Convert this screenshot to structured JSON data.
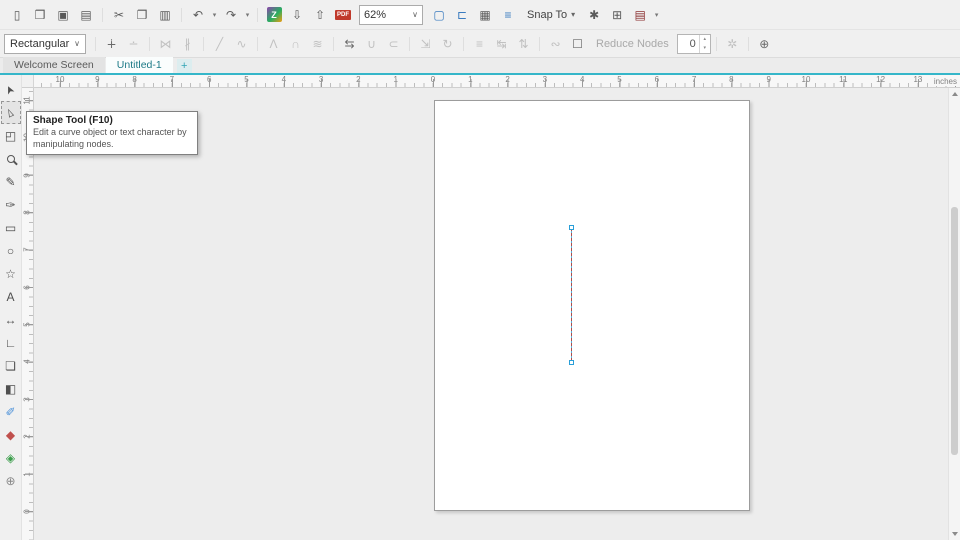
{
  "app": {
    "accent": "#35b6c9",
    "chrome_bg": "#f0f0f0"
  },
  "glyphs": {
    "combo_arrow": "∨",
    "dropdown": "▾",
    "spinner_up": "▴",
    "spinner_down": "▾"
  },
  "toolbar": {
    "zoom_value": "62%",
    "snap_label": "Snap To",
    "items": [
      {
        "name": "new-document-icon",
        "glyph": "▯"
      },
      {
        "name": "open-document-icon",
        "glyph": "❒"
      },
      {
        "name": "save-icon",
        "glyph": "▣"
      },
      {
        "name": "print-icon",
        "glyph": "▤"
      },
      {
        "sep": true
      },
      {
        "name": "cut-icon",
        "glyph": "✂"
      },
      {
        "name": "copy-icon",
        "glyph": "❐"
      },
      {
        "name": "paste-icon",
        "glyph": "▥"
      },
      {
        "sep": true
      },
      {
        "name": "undo-icon",
        "glyph": "↶"
      },
      {
        "name": "undo-dropdown-icon",
        "glyph": "▾",
        "small": true
      },
      {
        "name": "redo-icon",
        "glyph": "↷"
      },
      {
        "name": "redo-dropdown-icon",
        "glyph": "▾",
        "small": true
      },
      {
        "sep": true
      },
      {
        "name": "search-content-icon",
        "glyph": "Z",
        "special": "zbadge"
      },
      {
        "name": "import-icon",
        "glyph": "⇩"
      },
      {
        "name": "export-icon",
        "glyph": "⇧"
      },
      {
        "name": "publish-to-pdf-icon",
        "glyph": "PDF",
        "special": "pdf"
      },
      {
        "special": "zoom-combo"
      },
      {
        "name": "full-screen-preview-icon",
        "glyph": "▢",
        "color": "#3a7bbf"
      },
      {
        "name": "show-rulers-icon",
        "glyph": "⊏",
        "color": "#3a7bbf"
      },
      {
        "name": "show-grid-icon",
        "glyph": "▦"
      },
      {
        "name": "show-guidelines-icon",
        "glyph": "≡",
        "color": "#3a7bbf"
      },
      {
        "special": "snap"
      },
      {
        "name": "options-icon",
        "glyph": "✱"
      },
      {
        "name": "application-launcher-icon",
        "glyph": "⊞"
      },
      {
        "name": "workspace-icon",
        "glyph": "▤",
        "color": "#8b3030"
      },
      {
        "name": "workspace-dropdown-icon",
        "glyph": "▾",
        "small": true
      }
    ]
  },
  "property_bar": {
    "selection_mode": "Rectangular",
    "reduce_nodes_label": "Reduce Nodes",
    "smoothness_value": "0",
    "items": [
      {
        "special": "mode-combo"
      },
      {
        "sep": true
      },
      {
        "name": "add-nodes-icon",
        "glyph": "∔"
      },
      {
        "name": "delete-nodes-icon",
        "glyph": "∸",
        "disabled": true
      },
      {
        "sep": true
      },
      {
        "name": "join-nodes-icon",
        "glyph": "⋈",
        "disabled": true
      },
      {
        "name": "break-curve-icon",
        "glyph": "∦",
        "disabled": true
      },
      {
        "sep": true
      },
      {
        "name": "convert-to-line-icon",
        "glyph": "╱",
        "disabled": true
      },
      {
        "name": "convert-to-curve-icon",
        "glyph": "∿",
        "disabled": true
      },
      {
        "sep": true
      },
      {
        "name": "cusp-node-icon",
        "glyph": "Λ",
        "disabled": true
      },
      {
        "name": "smooth-node-icon",
        "glyph": "∩",
        "disabled": true
      },
      {
        "name": "symmetrical-node-icon",
        "glyph": "≋",
        "disabled": true
      },
      {
        "sep": true
      },
      {
        "name": "reverse-direction-icon",
        "glyph": "⇆"
      },
      {
        "name": "close-curve-icon",
        "glyph": "∪",
        "disabled": true
      },
      {
        "name": "extract-subpath-icon",
        "glyph": "⊂",
        "disabled": true
      },
      {
        "sep": true
      },
      {
        "name": "stretch-nodes-icon",
        "glyph": "⇲",
        "disabled": true
      },
      {
        "name": "rotate-skew-nodes-icon",
        "glyph": "↻",
        "disabled": true
      },
      {
        "sep": true
      },
      {
        "name": "align-nodes-icon",
        "glyph": "≡",
        "disabled": true
      },
      {
        "name": "reflect-horizontal-icon",
        "glyph": "↹",
        "disabled": true
      },
      {
        "name": "reflect-vertical-icon",
        "glyph": "⇅",
        "disabled": true
      },
      {
        "sep": true
      },
      {
        "name": "elastic-mode-icon",
        "glyph": "∾",
        "disabled": true
      },
      {
        "name": "select-all-nodes-icon",
        "glyph": "☐"
      },
      {
        "special": "reduce-label"
      },
      {
        "special": "spinner"
      },
      {
        "sep": true
      },
      {
        "name": "curve-smoothness-icon",
        "glyph": "✲",
        "disabled": true
      },
      {
        "sep": true
      },
      {
        "name": "more-options-icon",
        "glyph": "⊕"
      }
    ]
  },
  "tabs": {
    "items": [
      {
        "label": "Welcome Screen",
        "active": false
      },
      {
        "label": "Untitled-1",
        "active": true
      }
    ],
    "new_tab_label": "+"
  },
  "rulers": {
    "unit_label": "inches",
    "horizontal": [
      "10",
      "9",
      "8",
      "7",
      "6",
      "5",
      "4",
      "3",
      "2",
      "1",
      "0",
      "1",
      "2",
      "3",
      "4",
      "5",
      "6",
      "7",
      "8",
      "9",
      "10",
      "11",
      "12",
      "13"
    ],
    "vertical": [
      "11",
      "10",
      "9",
      "8",
      "7",
      "6",
      "5",
      "4",
      "3",
      "2",
      "1",
      "0"
    ]
  },
  "toolbox": {
    "tools": [
      {
        "name": "pick-tool",
        "glyph": "➤",
        "cls": "rot-arrow"
      },
      {
        "name": "shape-tool",
        "glyph": "▻",
        "cls": "rot-arrow",
        "selected": true
      },
      {
        "name": "crop-tool",
        "glyph": "◰"
      },
      {
        "name": "zoom-tool",
        "special": "magnifier"
      },
      {
        "name": "freehand-tool",
        "glyph": "✎"
      },
      {
        "name": "artistic-media-tool",
        "glyph": "✑"
      },
      {
        "name": "rectangle-tool",
        "glyph": "▭"
      },
      {
        "name": "ellipse-tool",
        "glyph": "○"
      },
      {
        "name": "polygon-tool",
        "glyph": "☆"
      },
      {
        "name": "text-tool",
        "glyph": "A"
      },
      {
        "name": "parallel-dimension-tool",
        "glyph": "↔"
      },
      {
        "name": "connector-tool",
        "glyph": "∟"
      },
      {
        "name": "drop-shadow-tool",
        "glyph": "❏"
      },
      {
        "name": "transparency-tool",
        "glyph": "◧"
      },
      {
        "name": "color-eyedropper-tool",
        "glyph": "✐",
        "color": "#4a90d9"
      },
      {
        "name": "interactive-fill-tool",
        "glyph": "◆",
        "color": "#c0504d"
      },
      {
        "name": "smart-fill-tool",
        "glyph": "◈",
        "color": "#3a9d4a"
      },
      {
        "name": "add-tools-button",
        "glyph": "⊕",
        "color": "#8a8a8a"
      }
    ]
  },
  "tooltip": {
    "title": "Shape Tool (F10)",
    "body": "Edit a curve object or text character by manipulating nodes."
  }
}
